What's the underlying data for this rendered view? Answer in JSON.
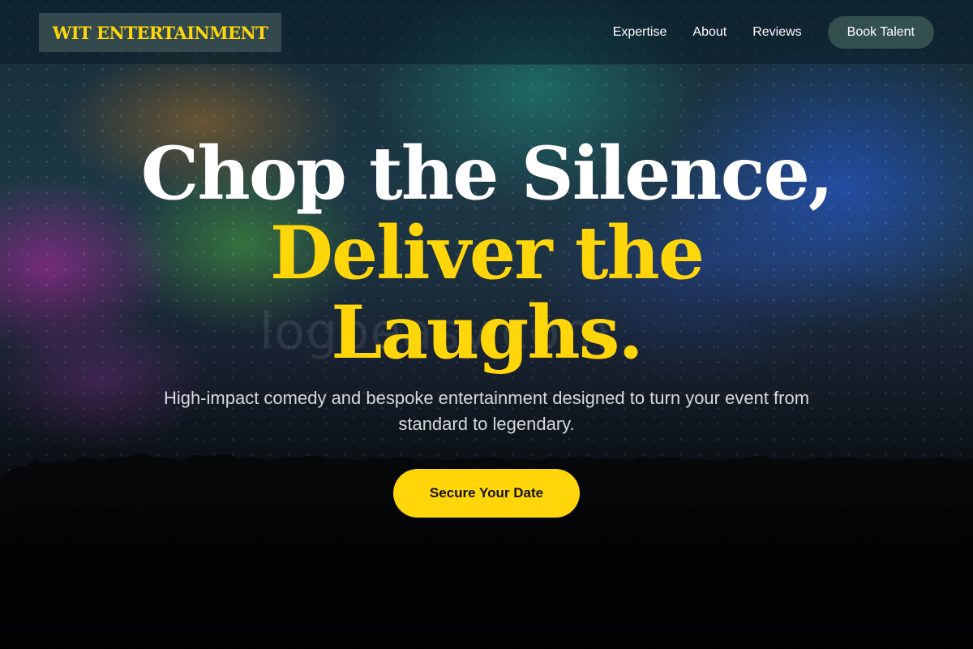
{
  "brand": {
    "logo_text": "WIT ENTERTAINMENT",
    "accent_color": "#ffd60a"
  },
  "nav": {
    "links": [
      {
        "label": "Expertise"
      },
      {
        "label": "About"
      },
      {
        "label": "Reviews"
      }
    ],
    "cta_label": "Book Talent"
  },
  "hero": {
    "headline_line1": "Chop the Silence,",
    "headline_line2": "Deliver the",
    "headline_line3": "Laughs.",
    "subtitle": "High-impact comedy and bespoke entertainment designed to turn your event from standard to legendary.",
    "cta_label": "Secure Your Date",
    "watermark": "logoeasy.com"
  }
}
